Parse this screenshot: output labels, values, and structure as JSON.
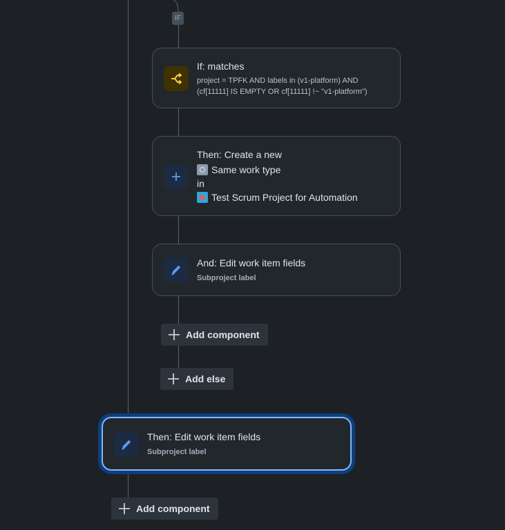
{
  "if_tag": "IF",
  "if_card": {
    "icon": "branch-icon",
    "title": "If: matches",
    "query_line1": "project = TPFK AND labels in (v1-platform) AND",
    "query_line2": "(cf[11111] IS EMPTY OR cf[11111] !~ \"v1-platform\")"
  },
  "create_card": {
    "icon": "plus-icon",
    "title": "Then: Create a new",
    "work_type": "Same work type",
    "in_label": "in",
    "project": "Test Scrum Project for Automation"
  },
  "edit_card_inner": {
    "icon": "pencil-icon",
    "title": "And: Edit work item fields",
    "subtitle": "Subproject label"
  },
  "add_component_inner": "Add component",
  "add_else": "Add else",
  "edit_card_outer": {
    "icon": "pencil-icon",
    "title": "Then: Edit work item fields",
    "subtitle": "Subproject label",
    "selected": true
  },
  "add_component_outer": "Add component",
  "colors": {
    "background": "#1d2125",
    "card": "#22272b",
    "selected_border": "#85b8ff",
    "connector": "#5a636b",
    "if_icon": "#f5cd47",
    "action_icon": "#579dff"
  }
}
